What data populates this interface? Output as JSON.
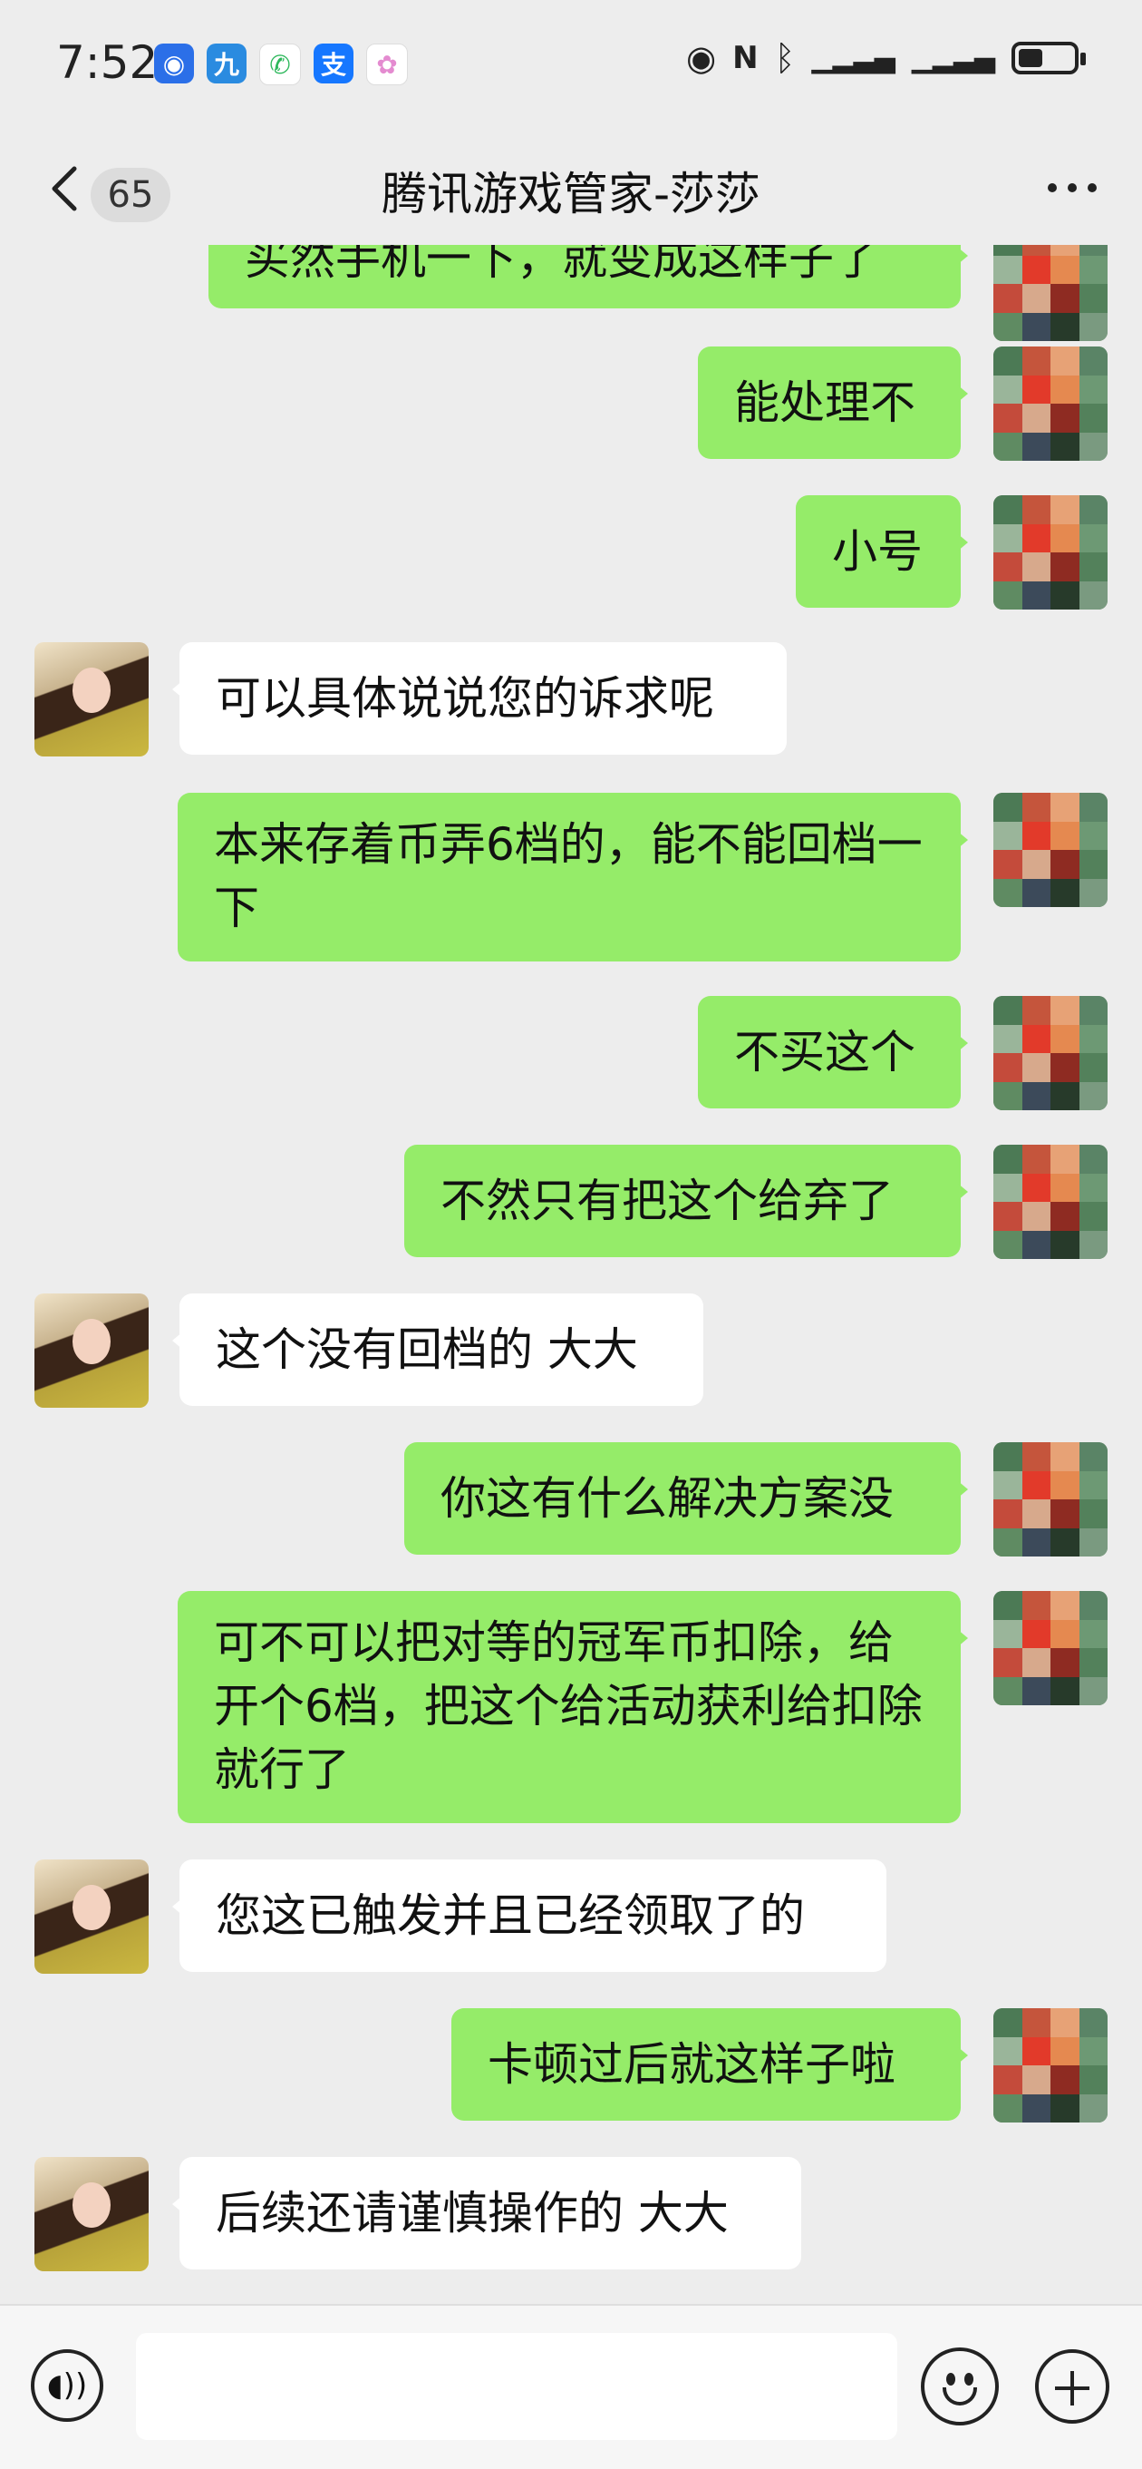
{
  "status_bar": {
    "time": "7:52",
    "app_icons": [
      "maps-icon",
      "app-icon",
      "phone-icon",
      "alipay-icon",
      "photos-icon"
    ],
    "system_icons": [
      "eye-icon",
      "nfc-icon",
      "bluetooth-icon",
      "signal-icon",
      "signal-icon",
      "battery-icon"
    ],
    "battery_level": 0.45
  },
  "header": {
    "unread_count": "65",
    "title": "腾讯游戏管家-莎莎"
  },
  "messages": [
    {
      "side": "right",
      "text": "买然手机一下，就变成这样子了"
    },
    {
      "side": "right",
      "text": "能处理不"
    },
    {
      "side": "right",
      "text": "小号"
    },
    {
      "side": "left",
      "text": "可以具体说说您的诉求呢"
    },
    {
      "side": "right",
      "text": "本来存着币弄6档的，能不能回档一下"
    },
    {
      "side": "right",
      "text": "不买这个"
    },
    {
      "side": "right",
      "text": "不然只有把这个给弃了"
    },
    {
      "side": "left",
      "text": "这个没有回档的 大大"
    },
    {
      "side": "right",
      "text": "你这有什么解决方案没"
    },
    {
      "side": "right",
      "text": "可不可以把对等的冠军币扣除，给开个6档，把这个给活动获利给扣除就行了"
    },
    {
      "side": "left",
      "text": "您这已触发并且已经领取了的"
    },
    {
      "side": "right",
      "text": "卡顿过后就这样子啦"
    },
    {
      "side": "left",
      "text": "后续还请谨慎操作的 大大"
    }
  ],
  "colors": {
    "background": "#ededed",
    "self_bubble": "#95ec69",
    "other_bubble": "#ffffff"
  }
}
